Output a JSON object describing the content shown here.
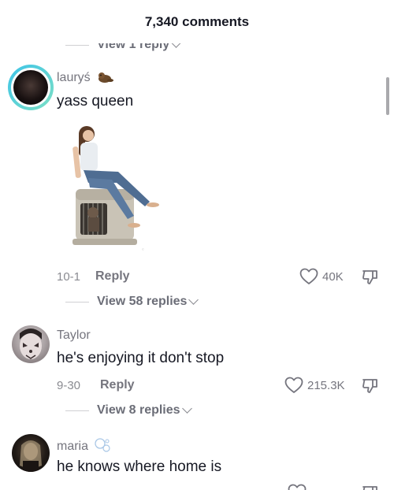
{
  "header": {
    "title": "7,340 comments"
  },
  "top_replies": {
    "label": "View 1 reply"
  },
  "comments": [
    {
      "username": "lauryś",
      "text": "yass queen",
      "date": "10-1",
      "reply_label": "Reply",
      "likes": "40K",
      "view_replies": "View 58 replies"
    },
    {
      "username": "Taylor",
      "text": "he's enjoying it don't stop",
      "date": "9-30",
      "reply_label": "Reply",
      "likes": "215.3K",
      "view_replies": "View 8 replies"
    },
    {
      "username": "maria",
      "text": "he knows where home is"
    }
  ],
  "colors": {
    "text_primary": "#161823",
    "text_secondary": "#75757e",
    "ring_gradient_start": "#3dc4e8",
    "ring_gradient_end": "#7de0c5"
  },
  "icons": [
    "heart-icon",
    "dislike-icon",
    "chevron-down-icon",
    "otter-emoji-icon",
    "bubbles-emoji-icon"
  ]
}
